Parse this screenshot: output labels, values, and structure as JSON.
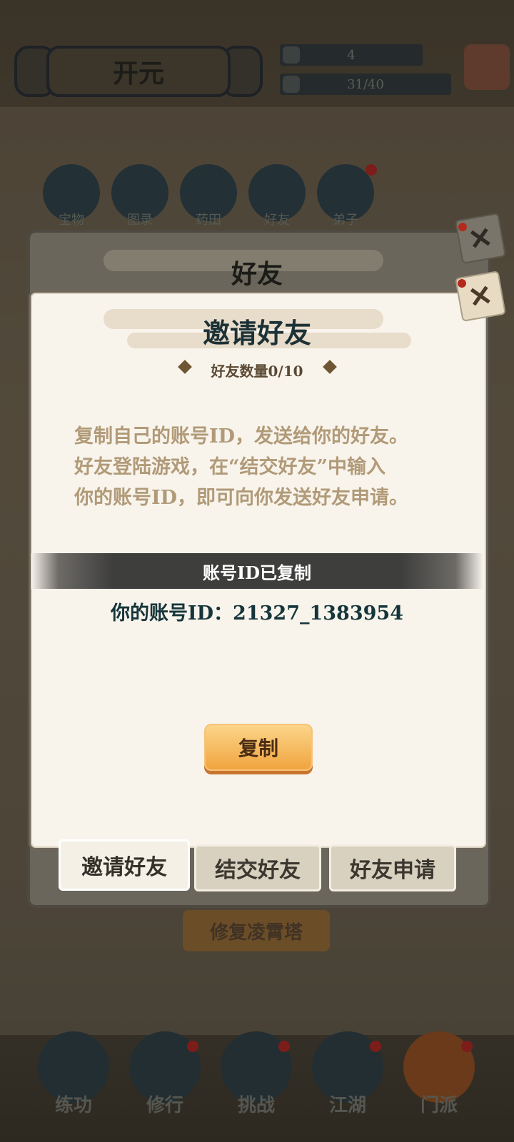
{
  "header": {
    "realm_name": "开元",
    "stat_1": "4",
    "stat_2": "31/40"
  },
  "quick_menu": [
    {
      "label": "宝物",
      "icon": "treasure-icon"
    },
    {
      "label": "图录",
      "icon": "scroll-icon"
    },
    {
      "label": "药田",
      "icon": "herb-icon"
    },
    {
      "label": "好友",
      "icon": "friends-icon"
    },
    {
      "label": "弟子",
      "icon": "disciple-icon"
    }
  ],
  "friends_panel": {
    "title": "好友"
  },
  "invite_dialog": {
    "title": "邀请好友",
    "friend_count": "好友数量0/10",
    "description_lines": [
      "复制自己的账号ID，发送给你的好友。",
      "好友登陆游戏，在“结交好友”中输入",
      "你的账号ID，即可向你发送好友申请。"
    ],
    "copied_toast": "账号ID已复制",
    "account_id_text": "你的账号ID：21327_1383954",
    "copy_button": "复制"
  },
  "tabs": [
    {
      "label": "邀请好友",
      "active": true
    },
    {
      "label": "结交好友",
      "active": false
    },
    {
      "label": "好友申请",
      "active": false
    }
  ],
  "background_button": "修复凌霄塔",
  "bottom_nav": [
    {
      "label": "练功",
      "icon": "martial-icon"
    },
    {
      "label": "修行",
      "icon": "heart-icon"
    },
    {
      "label": "挑战",
      "icon": "swords-icon"
    },
    {
      "label": "江湖",
      "icon": "mountain-icon"
    },
    {
      "label": "门派",
      "icon": "gate-icon"
    }
  ],
  "colors": {
    "modal_bg": "#f8f4ec",
    "title_text": "#1d3236",
    "desc_text": "#b19a78",
    "copy_button": "#f1a43f",
    "notify_dot": "#7d1d1a"
  }
}
